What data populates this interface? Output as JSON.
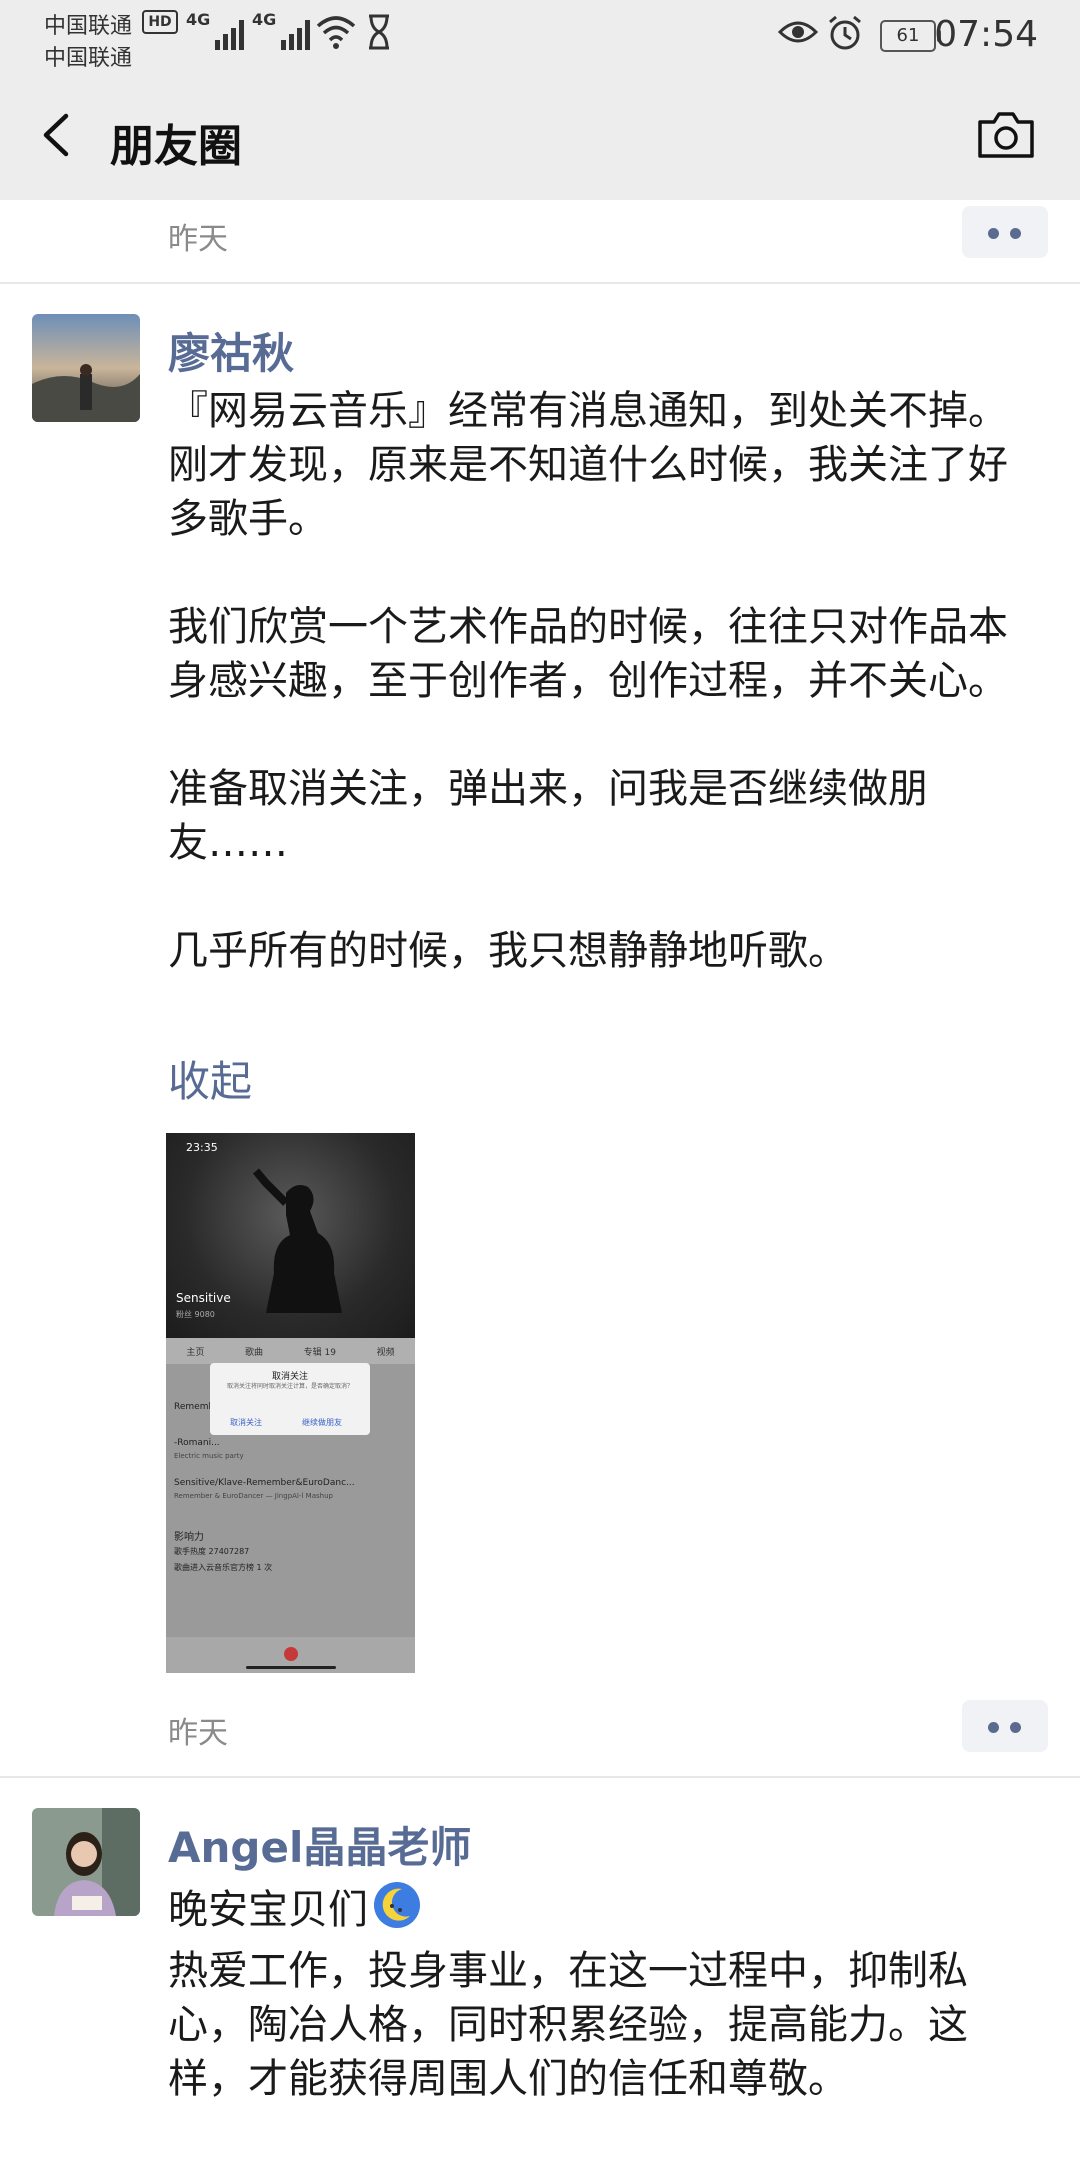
{
  "status_bar": {
    "carrier1": "中国联通",
    "carrier2": "中国联通",
    "hd_badge": "HD",
    "net1": "4G",
    "net2": "4G",
    "battery": "61",
    "time": "07:54"
  },
  "header": {
    "title": "朋友圈"
  },
  "posts": [
    {
      "time": "昨天"
    },
    {
      "name": "廖祜秋",
      "paragraphs": [
        "『网易云音乐』经常有消息通知，到处关不掉。刚才发现，原来是不知道什么时候，我关注了好多歌手。",
        "我们欣赏一个艺术作品的时候，往往只对作品本身感兴趣，至于创作者，创作过程，并不关心。",
        "准备取消关注，弹出来，问我是否继续做朋友……",
        "几乎所有的时候，我只想静静地听歌。"
      ],
      "collapse_label": "收起",
      "image": {
        "time": "23:35",
        "artist": "Sensitive",
        "fans": "粉丝 9080",
        "tabs": [
          "主页",
          "歌曲",
          "专辑 19",
          "视频"
        ],
        "rows": [
          "Rememb...",
          "-Romani...",
          "Electric music party",
          "Sensitive/Klave-Remember&EuroDanc...",
          "Remember & EuroDancer — JingpAI-l Mashup",
          "影响力",
          "歌手热度 27407287",
          "歌曲进入云音乐官方榜 1 次"
        ],
        "dialog_title": "取消关注",
        "dialog_message": "取消关注将同时取消关注计算，是否确定取消？",
        "dialog_cancel": "取消关注",
        "dialog_keep": "继续做朋友"
      },
      "time": "昨天"
    },
    {
      "name": "Angel晶晶老师",
      "first_line": "晚安宝贝们",
      "emoji": "moon-emoji",
      "paragraph": "热爱工作，投身事业，在这一过程中，抑制私心，陶冶人格，同时积累经验，提高能力。这样，才能获得周围人们的信任和尊敬。"
    }
  ]
}
